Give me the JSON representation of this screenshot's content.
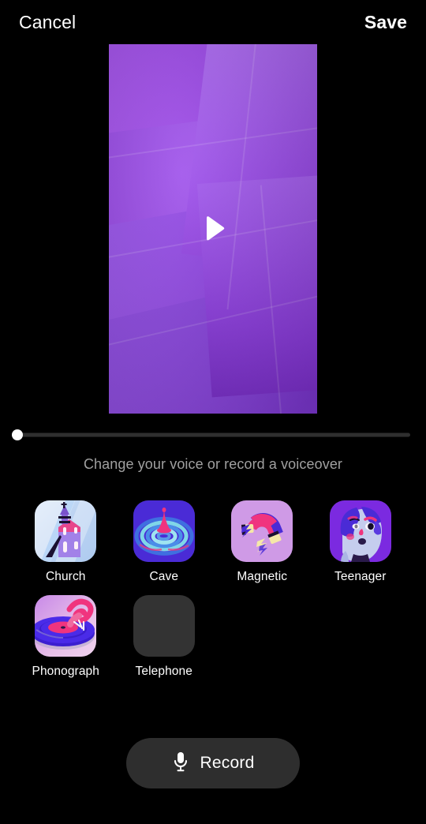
{
  "app": {
    "background_color": "#000000",
    "accent_color": "#8a3ce0"
  },
  "topbar": {
    "cancel_label": "Cancel",
    "save_label": "Save"
  },
  "preview": {
    "play_icon": "play-triangle-icon",
    "description": "abstract purple folded surface video frame"
  },
  "scrubber": {
    "position_percent": 0,
    "track_color": "#2f2f2f",
    "thumb_color": "#ffffff"
  },
  "hint": {
    "text": "Change your voice or record a voiceover"
  },
  "voice_effects": [
    {
      "label": "Church",
      "icon": "church-icon",
      "selected": false,
      "loaded": true
    },
    {
      "label": "Cave",
      "icon": "cave-ripple-icon",
      "selected": false,
      "loaded": true
    },
    {
      "label": "Magnetic",
      "icon": "magnet-icon",
      "selected": false,
      "loaded": true
    },
    {
      "label": "Teenager",
      "icon": "teen-face-icon",
      "selected": false,
      "loaded": true
    },
    {
      "label": "Phonograph",
      "icon": "turntable-icon",
      "selected": false,
      "loaded": true
    },
    {
      "label": "Telephone",
      "icon": "placeholder-icon",
      "selected": false,
      "loaded": false
    }
  ],
  "record": {
    "label": "Record",
    "icon": "microphone-icon",
    "background_color": "#2e2e2e"
  }
}
